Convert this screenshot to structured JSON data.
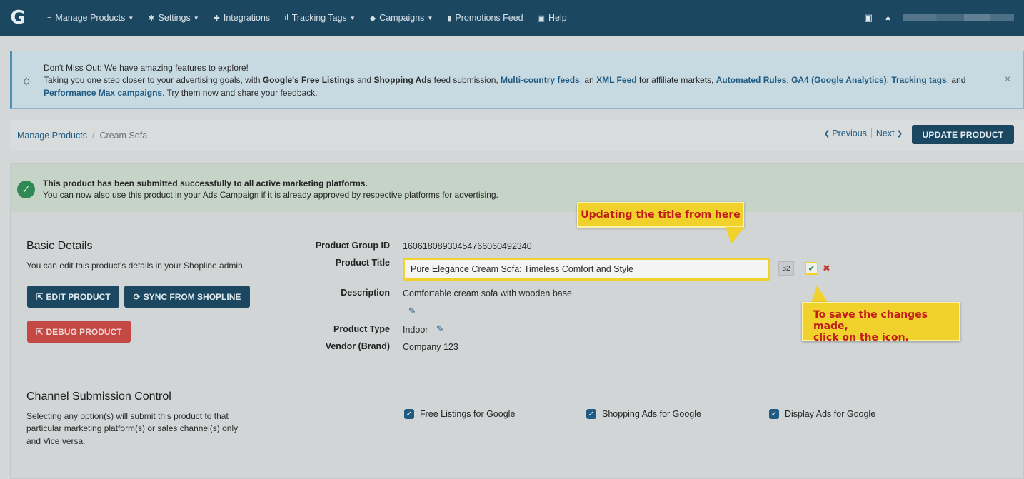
{
  "nav": {
    "logo": "G",
    "items": [
      {
        "icon": "≡",
        "label": "Manage Products",
        "caret": true
      },
      {
        "icon": "✱",
        "label": "Settings",
        "caret": true
      },
      {
        "icon": "✚",
        "label": "Integrations",
        "caret": false
      },
      {
        "icon": "ıl",
        "label": "Tracking Tags",
        "caret": true
      },
      {
        "icon": "◆",
        "label": "Campaigns",
        "caret": true
      },
      {
        "icon": "▮",
        "label": "Promotions Feed",
        "caret": false
      },
      {
        "icon": "▣",
        "label": "Help",
        "caret": false
      }
    ]
  },
  "banner": {
    "title": "Don't Miss Out: We have amazing features to explore!",
    "text_prefix": "Taking you one step closer to your advertising goals, with ",
    "b1": "Google's Free Listings",
    "and1": " and ",
    "b2": "Shopping Ads",
    "t2": " feed submission, ",
    "l1": "Multi-country feeds",
    "t3": ", an ",
    "l2": "XML Feed",
    "t4": " for affiliate markets, ",
    "l3": "Automated Rules",
    "t5": ", ",
    "l4": "GA4 (Google Analytics)",
    "t6": ", ",
    "l5": "Tracking tags",
    "t7": ", and",
    "l6": "Performance Max campaigns",
    "t8": ". Try them now and share your feedback.",
    "close": "×"
  },
  "breadcrumb": {
    "root": "Manage Products",
    "sep": "/",
    "current": "Cream Sofa"
  },
  "pager": {
    "prev": "Previous",
    "next": "Next"
  },
  "update_button": "UPDATE PRODUCT",
  "success": {
    "line1": "This product has been submitted successfully to all active marketing platforms.",
    "line2": "You can now also use this product in your Ads Campaign if it is already approved by respective platforms for advertising."
  },
  "basic": {
    "title": "Basic Details",
    "subtitle": "You can edit this product's details in your Shopline admin.",
    "edit_btn": "EDIT PRODUCT",
    "sync_btn": "SYNC FROM SHOPLINE",
    "debug_btn": "DEBUG PRODUCT"
  },
  "fields": {
    "group_id_label": "Product Group ID",
    "group_id": "16061808930454766060492340",
    "title_label": "Product Title",
    "title_value": "Pure Elegance Cream Sofa: Timeless Comfort and Style",
    "title_count": "52",
    "desc_label": "Description",
    "desc": "Comfortable cream sofa with wooden base",
    "type_label": "Product Type",
    "type": "Indoor",
    "vendor_label": "Vendor (Brand)",
    "vendor": "Company 123"
  },
  "callouts": {
    "title": "Updating the title from here",
    "save_1": "To save the changes made,",
    "save_2": "click on the icon."
  },
  "channel": {
    "title": "Channel Submission Control",
    "sub1": "Selecting any option(s) will submit this product to that",
    "sub2": "particular marketing platform(s) or sales channel(s) only",
    "sub3": "and Vice versa.",
    "options": [
      "Free Listings for Google",
      "Shopping Ads for Google",
      "Display Ads for Google"
    ]
  }
}
